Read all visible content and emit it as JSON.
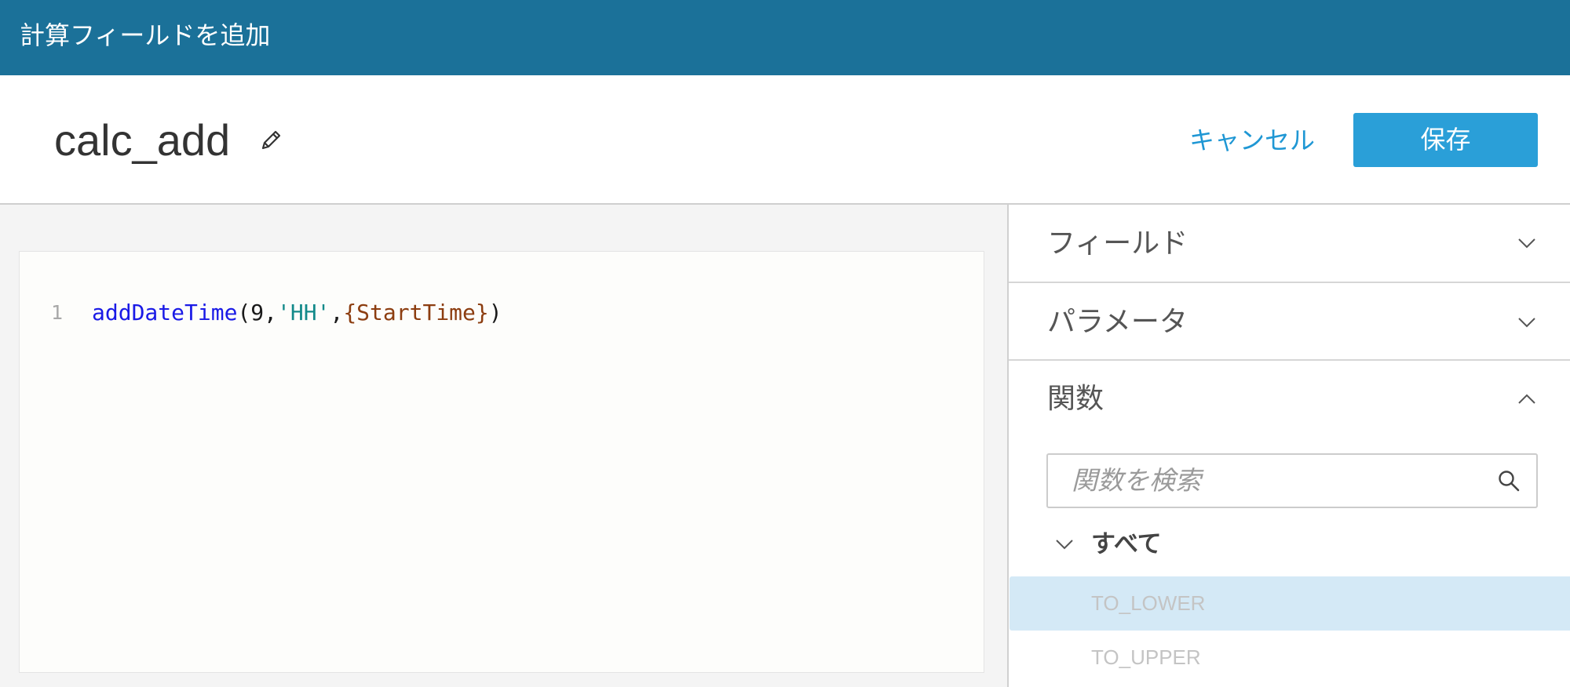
{
  "header": {
    "title": "計算フィールドを追加"
  },
  "field": {
    "name": "calc_add",
    "edit_icon": "pencil-icon"
  },
  "actions": {
    "cancel_label": "キャンセル",
    "save_label": "保存"
  },
  "editor": {
    "lines": [
      {
        "number": "1",
        "tokens": [
          {
            "text": "addDateTime",
            "color": "#1a1ae6"
          },
          {
            "text": "(9,",
            "color": "#1a1a1a"
          },
          {
            "text": "'HH'",
            "color": "#138a8a"
          },
          {
            "text": ",",
            "color": "#1a1a1a"
          },
          {
            "text": "{StartTime}",
            "color": "#8c3d10"
          },
          {
            "text": ")",
            "color": "#1a1a1a"
          }
        ]
      }
    ]
  },
  "sidebar": {
    "sections": [
      {
        "label": "フィールド",
        "expanded": false,
        "toggle_icon": "chevron-down-icon"
      },
      {
        "label": "パラメータ",
        "expanded": false,
        "toggle_icon": "chevron-down-icon"
      },
      {
        "label": "関数",
        "expanded": true,
        "toggle_icon": "chevron-up-icon"
      }
    ],
    "functions": {
      "search_placeholder": "関数を検索",
      "search_icon": "search-icon",
      "category": {
        "label": "すべて",
        "expanded": true,
        "toggle_icon": "chevron-down-icon"
      },
      "items": [
        {
          "label": "TO_LOWER",
          "selected": true
        },
        {
          "label": "TO_UPPER",
          "selected": false
        }
      ]
    }
  },
  "colors": {
    "header_bg": "#1b7199",
    "accent": "#1f97d4",
    "save_button_bg": "#2a9fd8",
    "selected_row_bg": "#d4e9f6",
    "function_item_text": "#c4c4c4"
  }
}
